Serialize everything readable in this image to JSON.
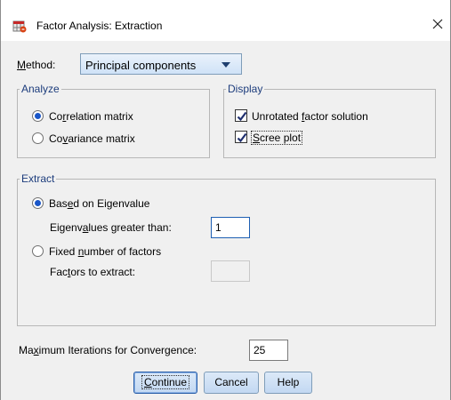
{
  "window": {
    "title": "Factor Analysis: Extraction",
    "close_glyph": "✕",
    "app_icon": "spss-app-icon"
  },
  "method": {
    "label": "Method:",
    "selected": "Principal components"
  },
  "analyze": {
    "legend": "Analyze",
    "options": [
      {
        "label": "Correlation matrix",
        "selected": true
      },
      {
        "label": "Covariance matrix",
        "selected": false
      }
    ]
  },
  "display": {
    "legend": "Display",
    "options": [
      {
        "label": "Unrotated factor solution",
        "checked": true
      },
      {
        "label": "Scree plot",
        "checked": true
      }
    ]
  },
  "extract": {
    "legend": "Extract",
    "based_on_eigenvalue": {
      "label": "Based on Eigenvalue",
      "selected": true
    },
    "eigen_greater_label": "Eigenvalues greater than:",
    "eigen_value": "1",
    "fixed_number": {
      "label": "Fixed number of factors",
      "selected": false
    },
    "factors_to_extract_label": "Factors to extract:",
    "factors_value": ""
  },
  "iterations": {
    "label": "Maximum Iterations for Convergence:",
    "value": "25"
  },
  "buttons": {
    "continue": "Continue",
    "cancel": "Cancel",
    "help": "Help"
  }
}
